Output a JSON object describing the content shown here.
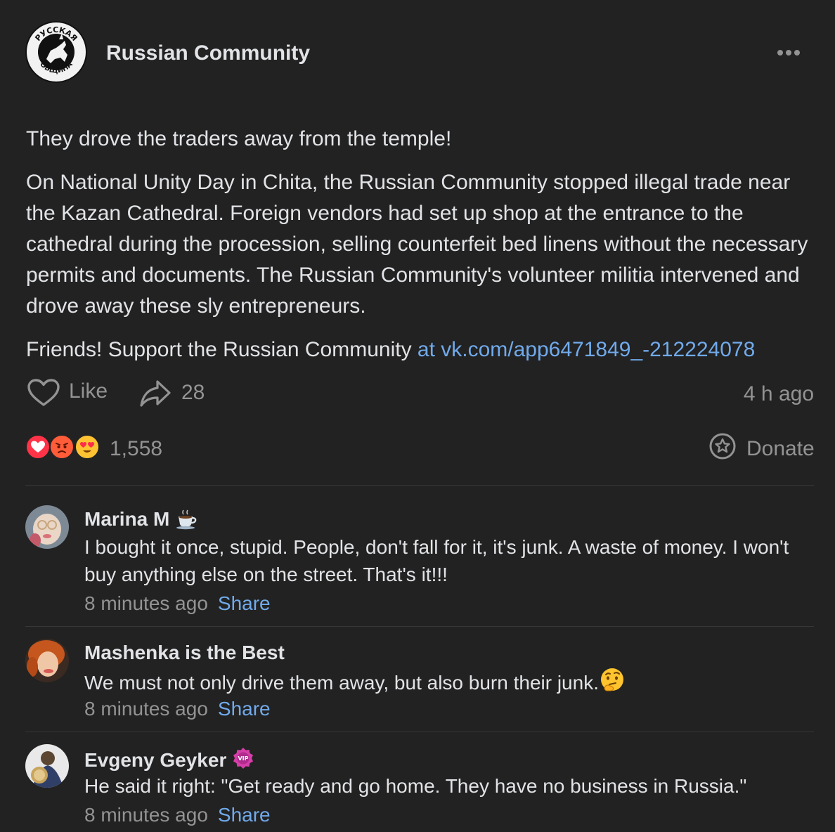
{
  "post": {
    "author": "Russian Community",
    "logo_text_top": "РУССКАЯ",
    "logo_text_bottom": "ОБЩИНА",
    "title": "They drove the traders away from the temple!",
    "body": "On National Unity Day in Chita, the Russian Community stopped illegal trade near the Kazan Cathedral. Foreign vendors had set up shop at the entrance to the cathedral during the procession, selling counterfeit bed linens without the necessary permits and documents. The Russian Community's volunteer militia intervened and drove away these sly entrepreneurs.",
    "support_text": "Friends! Support the Russian Community ",
    "support_link": "at vk.com/app6471849_-212224078",
    "like_label": "Like",
    "share_count": "28",
    "time_ago": "4 h ago",
    "reactions_count": "1,558",
    "donate_label": "Donate",
    "reaction_icons": [
      "heart-reaction-icon",
      "angry-reaction-icon",
      "heart-eyes-reaction-icon"
    ]
  },
  "comments": [
    {
      "name": "Marina M",
      "badge": "coffee-cup-icon",
      "text": "I bought it once, stupid. People, don't fall for it, it's junk. A waste of money. I won't buy anything else on the street. That's it!!!",
      "time": "8 minutes ago",
      "share": "Share"
    },
    {
      "name": "Mashenka is the Best",
      "text": "We must not only drive them away, but also burn their junk.",
      "emoji": "thinking-face-icon",
      "time": "8 minutes ago",
      "share": "Share"
    },
    {
      "name": "Evgeny Geyker",
      "badge": "vip-badge-icon",
      "badge_text": "VIP",
      "text": "He said it right: \"Get ready and go home. They have no business in Russia.\"",
      "time": "8 minutes ago",
      "share": "Share"
    }
  ],
  "colors": {
    "background": "#222222",
    "text": "#e1e3e6",
    "secondary": "#939393",
    "link": "#71aaeb"
  }
}
